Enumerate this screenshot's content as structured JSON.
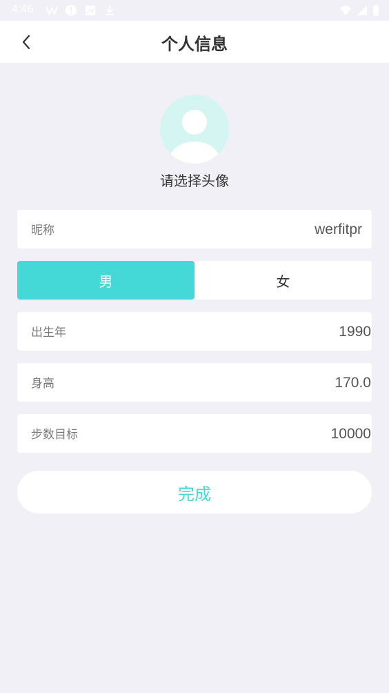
{
  "status_bar": {
    "time": "4:46",
    "icons_left": [
      "w-icon",
      "alert-icon",
      "image-icon",
      "download-icon"
    ],
    "icons_right": [
      "wifi-icon",
      "signal-icon",
      "battery-icon"
    ]
  },
  "header": {
    "title": "个人信息",
    "back_icon": "chevron-left-icon"
  },
  "avatar": {
    "prompt": "请选择头像"
  },
  "form": {
    "nickname": {
      "label": "昵称",
      "value": "werfitpr"
    },
    "gender": {
      "male": "男",
      "female": "女",
      "selected": "男"
    },
    "birth_year": {
      "label": "出生年",
      "value": "1990"
    },
    "height": {
      "label": "身高",
      "value": "170.0"
    },
    "step_goal": {
      "label": "步数目标",
      "value": "10000"
    }
  },
  "actions": {
    "done_label": "完成"
  },
  "colors": {
    "accent": "#44d8d6",
    "background": "#f1f0f6",
    "avatar_bg": "#d5f5f3"
  }
}
